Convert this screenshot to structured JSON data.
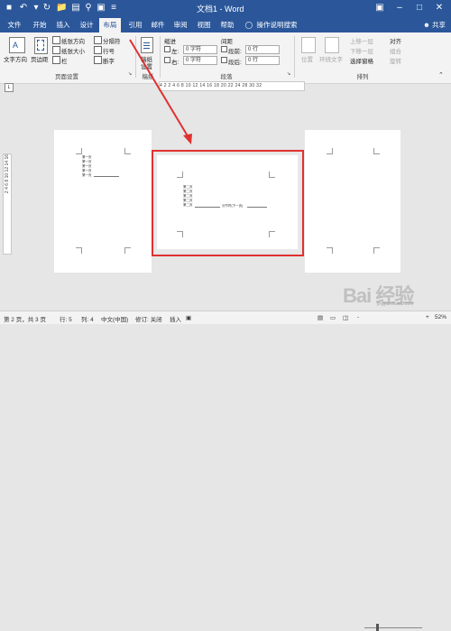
{
  "titlebar": {
    "title": "文档1 - Word",
    "quick_access": [
      "save-icon",
      "undo-icon",
      "redo-icon",
      "open-icon",
      "print-preview-icon",
      "search-icon",
      "image-icon",
      "more-icon"
    ],
    "window_controls": [
      "ribbon-display-icon",
      "minimize-icon",
      "maximize-icon",
      "close-icon"
    ]
  },
  "tabs": {
    "items": [
      "文件",
      "开始",
      "插入",
      "设计",
      "布局",
      "引用",
      "邮件",
      "审阅",
      "视图",
      "帮助"
    ],
    "active": "布局",
    "tell_me": "操作说明搜索",
    "share": "共享"
  },
  "ribbon": {
    "page_setup": {
      "text_direction": "文字方向",
      "margins": "页边距",
      "orientation": "纸张方向",
      "size": "纸张大小",
      "columns": "栏",
      "breaks": "分隔符",
      "line_numbers": "行号",
      "hyphenation": "断字",
      "group_label": "页面设置"
    },
    "draft": {
      "paper": "稿纸",
      "settings": "设置",
      "group_label": "稿纸"
    },
    "paragraph": {
      "indent_header": "缩进",
      "spacing_header": "间距",
      "left_label": "左:",
      "left_value": "0 字符",
      "right_label": "右:",
      "right_value": "0 字符",
      "before_label": "段前:",
      "before_value": "0 行",
      "after_label": "段后:",
      "after_value": "0 行",
      "group_label": "段落"
    },
    "arrange": {
      "position": "位置",
      "wrap_text": "环绕文字",
      "bring_forward": "上移一层",
      "send_backward": "下移一层",
      "selection_pane": "选择窗格",
      "align": "对齐",
      "group": "组合",
      "rotate": "旋转",
      "group_label": "排列"
    }
  },
  "ruler": {
    "horizontal": "4  2     2  4  6  8  10  12  14  16  18  20  22  24     28  30  32",
    "vertical": "2  4  6  8  10  12  14  16",
    "corner": "L"
  },
  "pages": {
    "page1_lines": [
      "第一页",
      "第一页",
      "第一页",
      "第一页",
      "第一页"
    ],
    "page2_lines": [
      "第二页",
      "第二页",
      "第二页",
      "第二页",
      "第二页"
    ],
    "page2_inline_text": "分节符(下一页)"
  },
  "status": {
    "page": "第 2 页，共 3 页",
    "line": "行: 5",
    "column": "列: 4",
    "language": "中文(中国)",
    "track_changes": "修订: 关闭",
    "insert": "插入",
    "zoom_minus": "-",
    "zoom_plus": "+",
    "zoom": "52%"
  },
  "watermark": {
    "text": "Bai 经验",
    "sub": "jingyan.baidu.com"
  },
  "colors": {
    "word_blue": "#2b579a",
    "highlight_red": "#e03131"
  }
}
